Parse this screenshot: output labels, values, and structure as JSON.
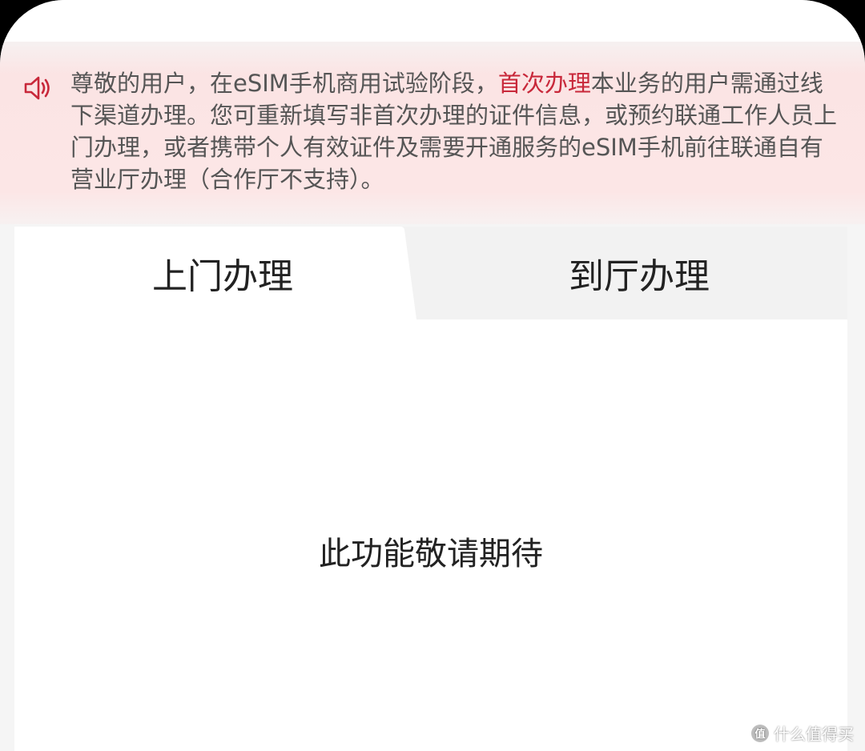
{
  "notice": {
    "icon": "speaker-icon",
    "text_before": "尊敬的用户，在eSIM手机商用试验阶段，",
    "highlight": "首次办理",
    "text_after": "本业务的用户需通过线下渠道办理。您可重新填写非首次办理的证件信息，或预约联通工作人员上门办理，或者携带个人有效证件及需要开通服务的eSIM手机前往联通自有营业厅办理（合作厅不支持）。",
    "highlight_color": "#c8283a"
  },
  "tabs": [
    {
      "label": "上门办理",
      "active": true
    },
    {
      "label": "到厅办理",
      "active": false
    }
  ],
  "content": {
    "message": "此功能敬请期待"
  },
  "watermark": {
    "logo_text": "值",
    "text": "什么值得买"
  }
}
